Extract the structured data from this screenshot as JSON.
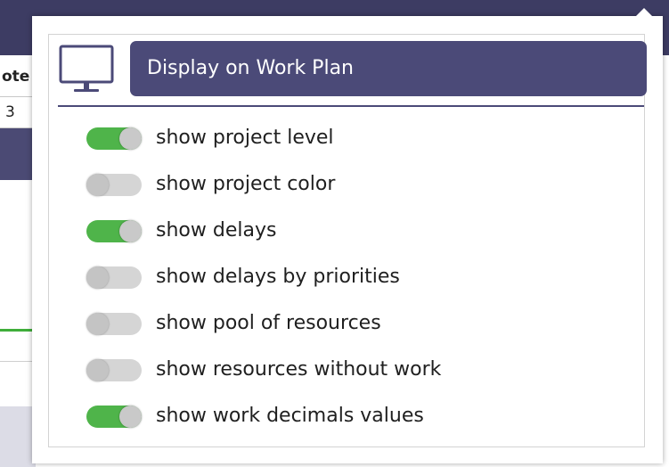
{
  "background": {
    "header_fragment": "ote",
    "cell_value": "3"
  },
  "popover": {
    "icon": "monitor-icon",
    "title": "Display on Work Plan",
    "accent_color": "#4b4a78",
    "toggle_on_color": "#4fb44a",
    "toggle_off_color": "#d5d5d5",
    "options": [
      {
        "label": "show project level",
        "enabled": true
      },
      {
        "label": "show project color",
        "enabled": false
      },
      {
        "label": "show delays",
        "enabled": true
      },
      {
        "label": "show delays by priorities",
        "enabled": false
      },
      {
        "label": "show pool of resources",
        "enabled": false
      },
      {
        "label": "show resources without work",
        "enabled": false
      },
      {
        "label": "show work decimals values",
        "enabled": true
      }
    ]
  }
}
